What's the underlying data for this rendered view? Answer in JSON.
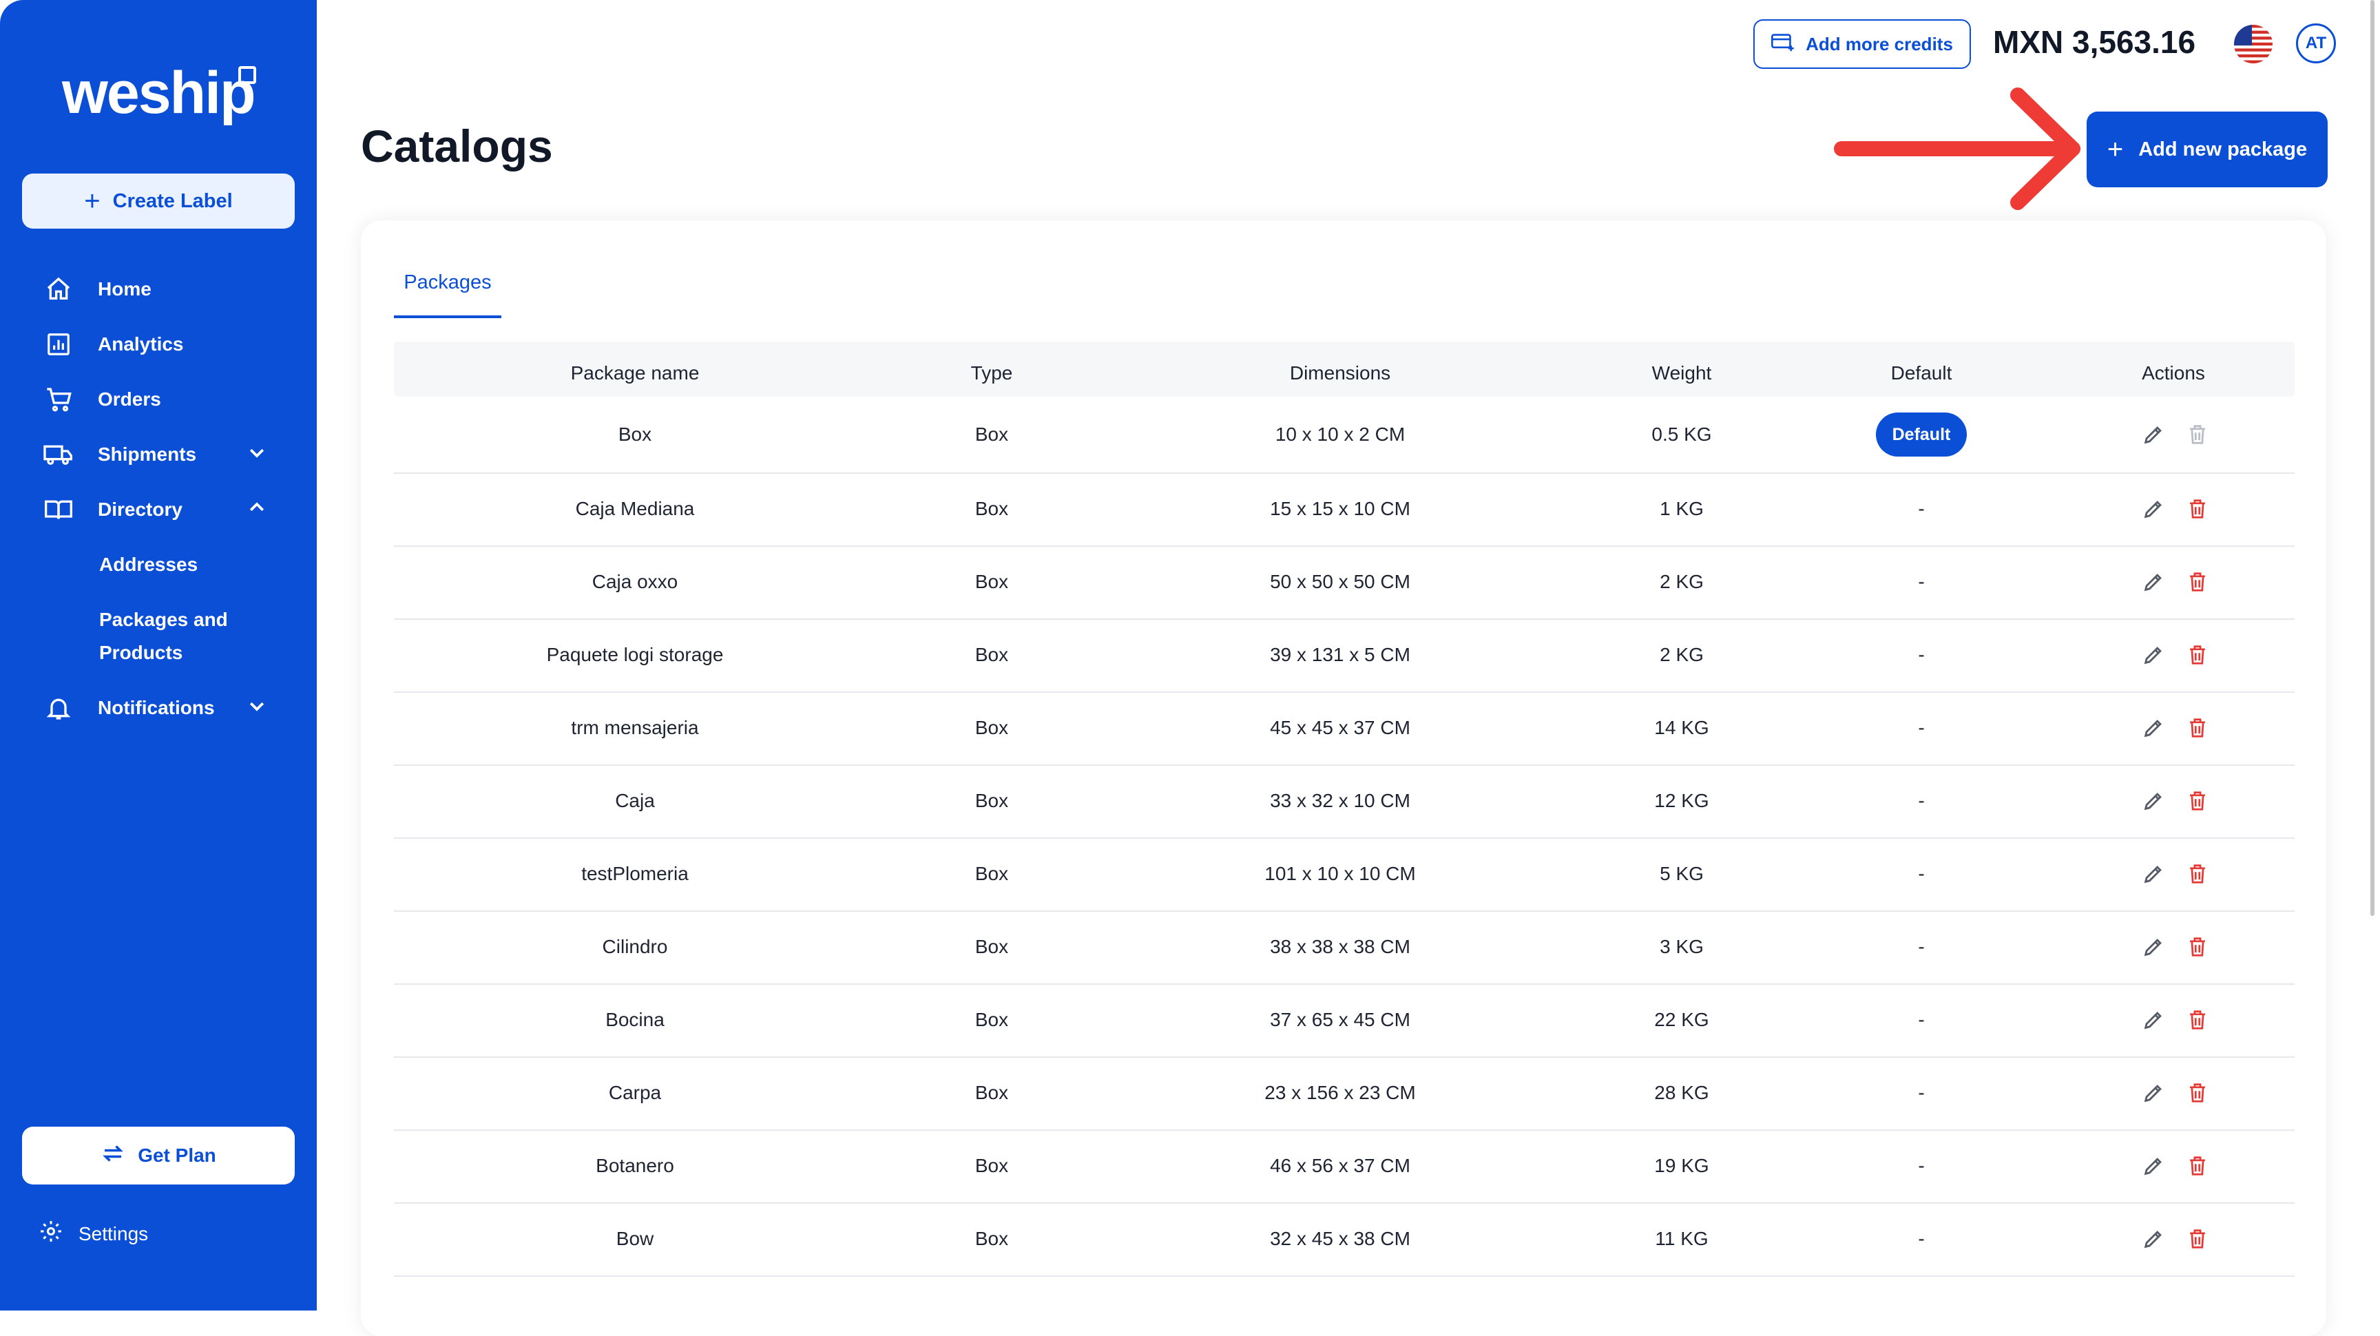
{
  "sidebar": {
    "logo": "weship",
    "create_label": "Create Label",
    "nav": [
      {
        "label": "Home",
        "icon": "home-icon"
      },
      {
        "label": "Analytics",
        "icon": "analytics-icon"
      },
      {
        "label": "Orders",
        "icon": "cart-icon"
      },
      {
        "label": "Shipments",
        "icon": "truck-icon"
      },
      {
        "label": "Directory",
        "icon": "book-icon"
      },
      {
        "label": "Notifications",
        "icon": "bell-icon"
      }
    ],
    "sub_items": [
      "Addresses",
      "Packages and",
      "Products"
    ],
    "get_plan": "Get Plan",
    "settings": "Settings"
  },
  "header": {
    "add_credits": "Add more credits",
    "balance": "MXN 3,563.16",
    "avatar_initials": "AT"
  },
  "page": {
    "title": "Catalogs",
    "add_package": "Add new package",
    "tab": "Packages"
  },
  "table": {
    "columns": [
      "Package name",
      "Type",
      "Dimensions",
      "Weight",
      "Default",
      "Actions"
    ],
    "rows": [
      {
        "name": "Box",
        "type": "Box",
        "dimensions": "10 x 10 x 2 CM",
        "weight": "0.5 KG",
        "default": "Default"
      },
      {
        "name": "Caja Mediana",
        "type": "Box",
        "dimensions": "15 x 15 x 10 CM",
        "weight": "1 KG",
        "default": "-"
      },
      {
        "name": "Caja oxxo",
        "type": "Box",
        "dimensions": "50 x 50 x 50 CM",
        "weight": "2 KG",
        "default": "-"
      },
      {
        "name": "Paquete logi storage",
        "type": "Box",
        "dimensions": "39 x 131 x 5 CM",
        "weight": "2 KG",
        "default": "-"
      },
      {
        "name": "trm mensajeria",
        "type": "Box",
        "dimensions": "45 x 45 x 37 CM",
        "weight": "14 KG",
        "default": "-"
      },
      {
        "name": "Caja",
        "type": "Box",
        "dimensions": "33 x 32 x 10 CM",
        "weight": "12 KG",
        "default": "-"
      },
      {
        "name": "testPlomeria",
        "type": "Box",
        "dimensions": "101 x 10 x 10 CM",
        "weight": "5 KG",
        "default": "-"
      },
      {
        "name": "Cilindro",
        "type": "Box",
        "dimensions": "38 x 38 x 38 CM",
        "weight": "3 KG",
        "default": "-"
      },
      {
        "name": "Bocina",
        "type": "Box",
        "dimensions": "37 x 65 x 45 CM",
        "weight": "22 KG",
        "default": "-"
      },
      {
        "name": "Carpa",
        "type": "Box",
        "dimensions": "23 x 156 x 23 CM",
        "weight": "28 KG",
        "default": "-"
      },
      {
        "name": "Botanero",
        "type": "Box",
        "dimensions": "46 x 56 x 37 CM",
        "weight": "19 KG",
        "default": "-"
      },
      {
        "name": "Bow",
        "type": "Box",
        "dimensions": "32 x 45 x 38 CM",
        "weight": "11 KG",
        "default": "-"
      }
    ]
  },
  "colors": {
    "brand": "#0a4fd6",
    "delete": "#e53935",
    "annotation_arrow": "#ef3b36"
  }
}
